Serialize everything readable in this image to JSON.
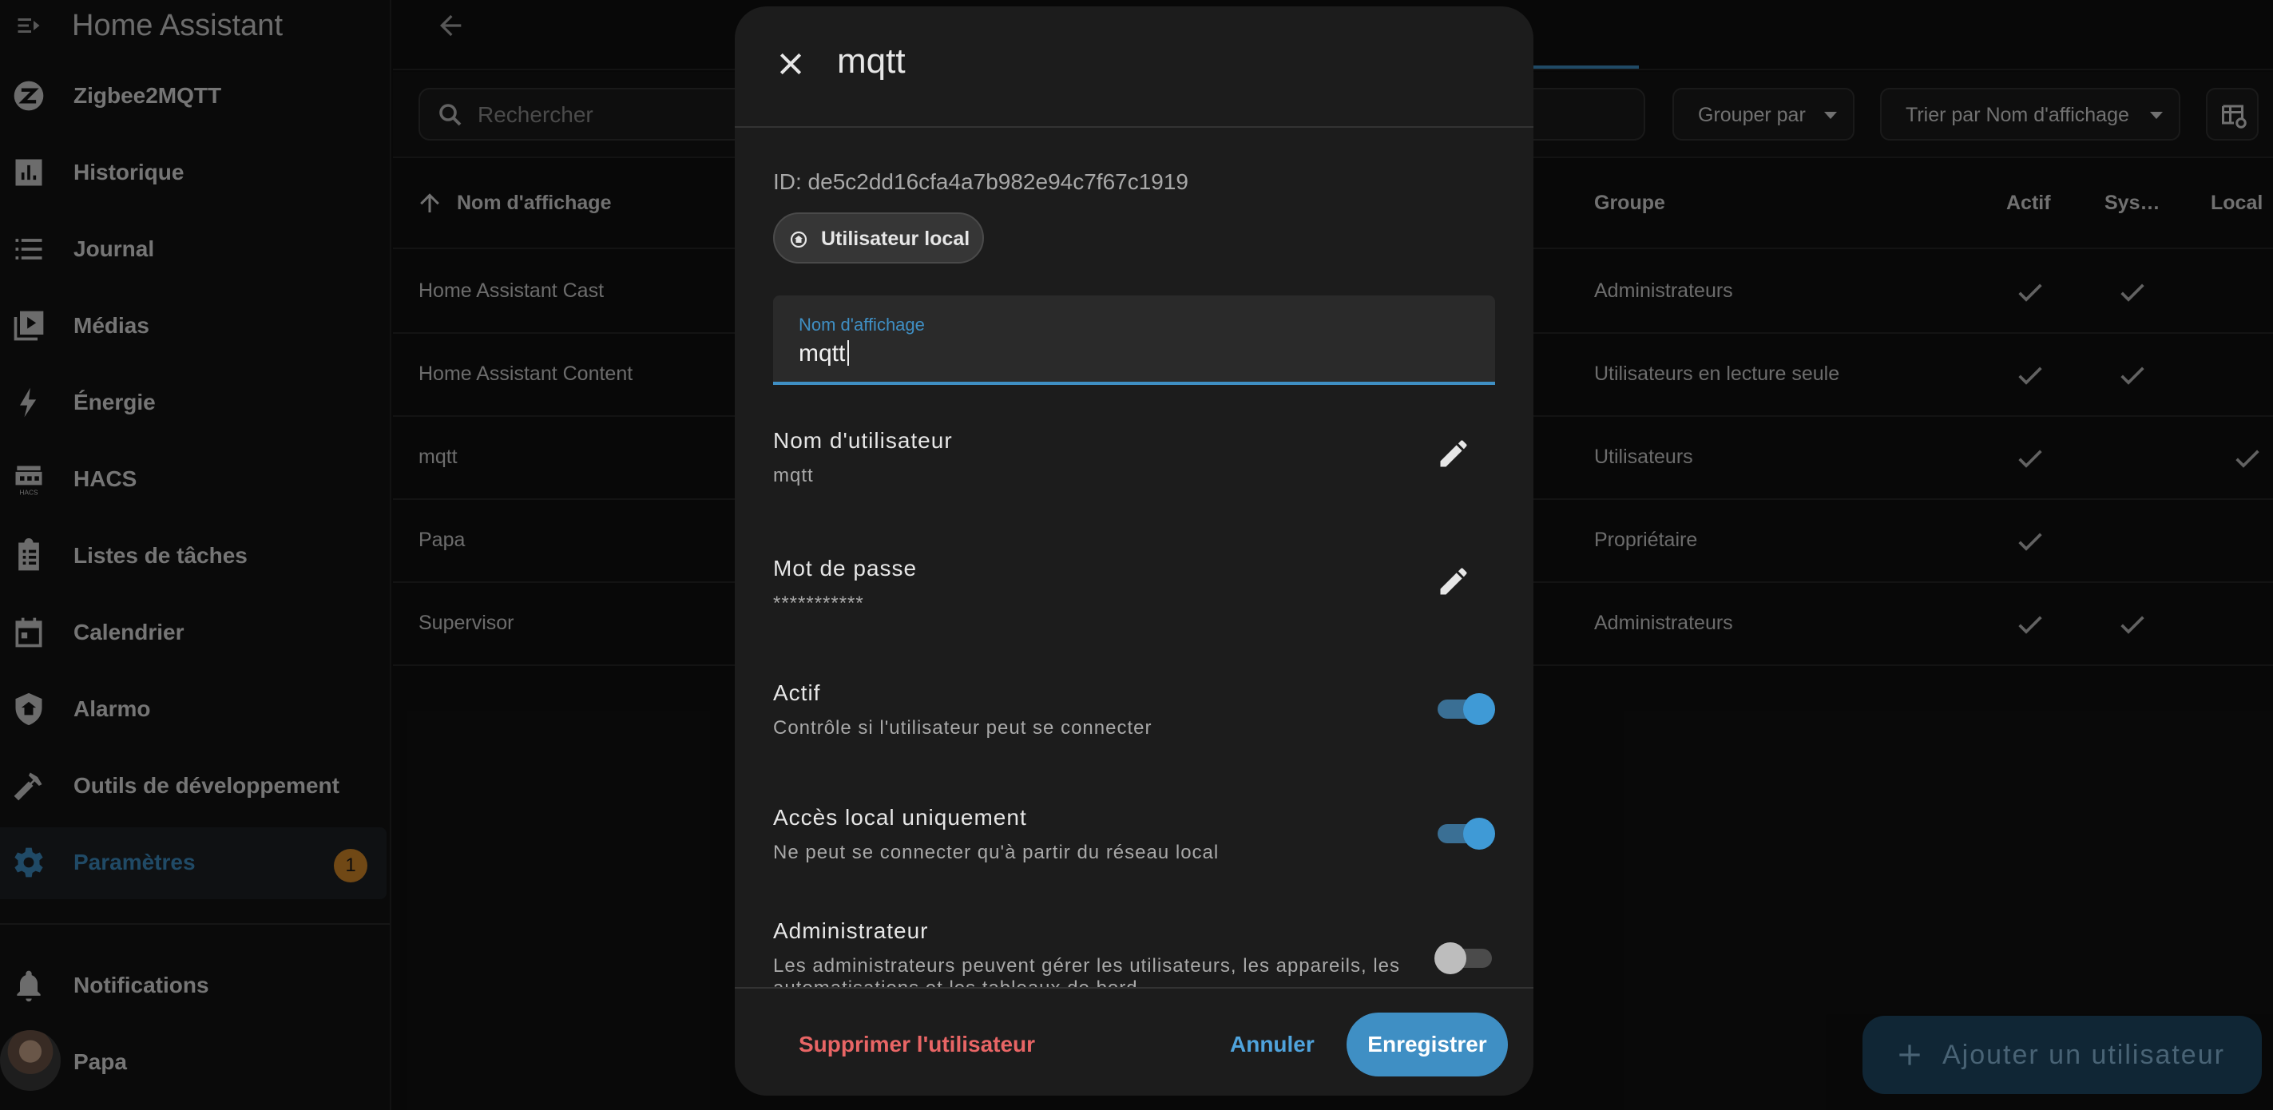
{
  "app": {
    "title": "Home Assistant"
  },
  "sidebar": {
    "items": [
      {
        "label": "Zigbee2MQTT",
        "icon": "zigbee-icon"
      },
      {
        "label": "Historique",
        "icon": "chart-bar-icon"
      },
      {
        "label": "Journal",
        "icon": "format-list-icon"
      },
      {
        "label": "Médias",
        "icon": "play-box-icon"
      },
      {
        "label": "Énergie",
        "icon": "lightning-bolt-icon"
      },
      {
        "label": "HACS",
        "icon": "hacs-icon"
      },
      {
        "label": "Listes de tâches",
        "icon": "clipboard-list-icon"
      },
      {
        "label": "Calendrier",
        "icon": "calendar-icon"
      },
      {
        "label": "Alarmo",
        "icon": "shield-home-icon"
      },
      {
        "label": "Outils de développement",
        "icon": "hammer-icon"
      },
      {
        "label": "Paramètres",
        "icon": "cog-icon",
        "badge": "1",
        "active": true
      }
    ],
    "notifications_label": "Notifications",
    "user_label": "Papa"
  },
  "toolbar": {
    "search_placeholder": "Rechercher",
    "group_by_label": "Grouper par",
    "sort_by_label": "Trier par Nom d'affichage"
  },
  "table": {
    "columns": {
      "name": "Nom d'affichage",
      "group": "Groupe",
      "active": "Actif",
      "system": "Sys…",
      "local": "Local"
    },
    "rows": [
      {
        "name": "Home Assistant Cast",
        "group": "Administrateurs",
        "active": true,
        "system": true,
        "local": false
      },
      {
        "name": "Home Assistant Content",
        "group": "Utilisateurs en lecture seule",
        "active": true,
        "system": true,
        "local": false
      },
      {
        "name": "mqtt",
        "group": "Utilisateurs",
        "active": true,
        "system": false,
        "local": true
      },
      {
        "name": "Papa",
        "group": "Propriétaire",
        "active": true,
        "system": false,
        "local": false
      },
      {
        "name": "Supervisor",
        "group": "Administrateurs",
        "active": true,
        "system": true,
        "local": false
      }
    ]
  },
  "fab": {
    "label": "Ajouter un utilisateur"
  },
  "dialog": {
    "title": "mqtt",
    "id_text": "ID: de5c2dd16cfa4a7b982e94c7f67c1919",
    "chip_label": "Utilisateur local",
    "display_name_label": "Nom d'affichage",
    "display_name_value": "mqtt",
    "username_title": "Nom d'utilisateur",
    "username_value": "mqtt",
    "password_title": "Mot de passe",
    "password_value": "***********",
    "active_title": "Actif",
    "active_sub": "Contrôle si l'utilisateur peut se connecter",
    "active_on": true,
    "local_title": "Accès local uniquement",
    "local_sub": "Ne peut se connecter qu'à partir du réseau local",
    "local_on": true,
    "admin_title": "Administrateur",
    "admin_sub_line1": "Les administrateurs peuvent gérer les utilisateurs, les appareils, les",
    "admin_sub_line2": "automatisations et les tableaux de bord",
    "admin_on": false,
    "delete_label": "Supprimer l'utilisateur",
    "cancel_label": "Annuler",
    "save_label": "Enregistrer"
  },
  "colors": {
    "accent": "#3f8fc4",
    "danger": "#e86565",
    "badge": "#d68a2a",
    "background": "#111111"
  }
}
